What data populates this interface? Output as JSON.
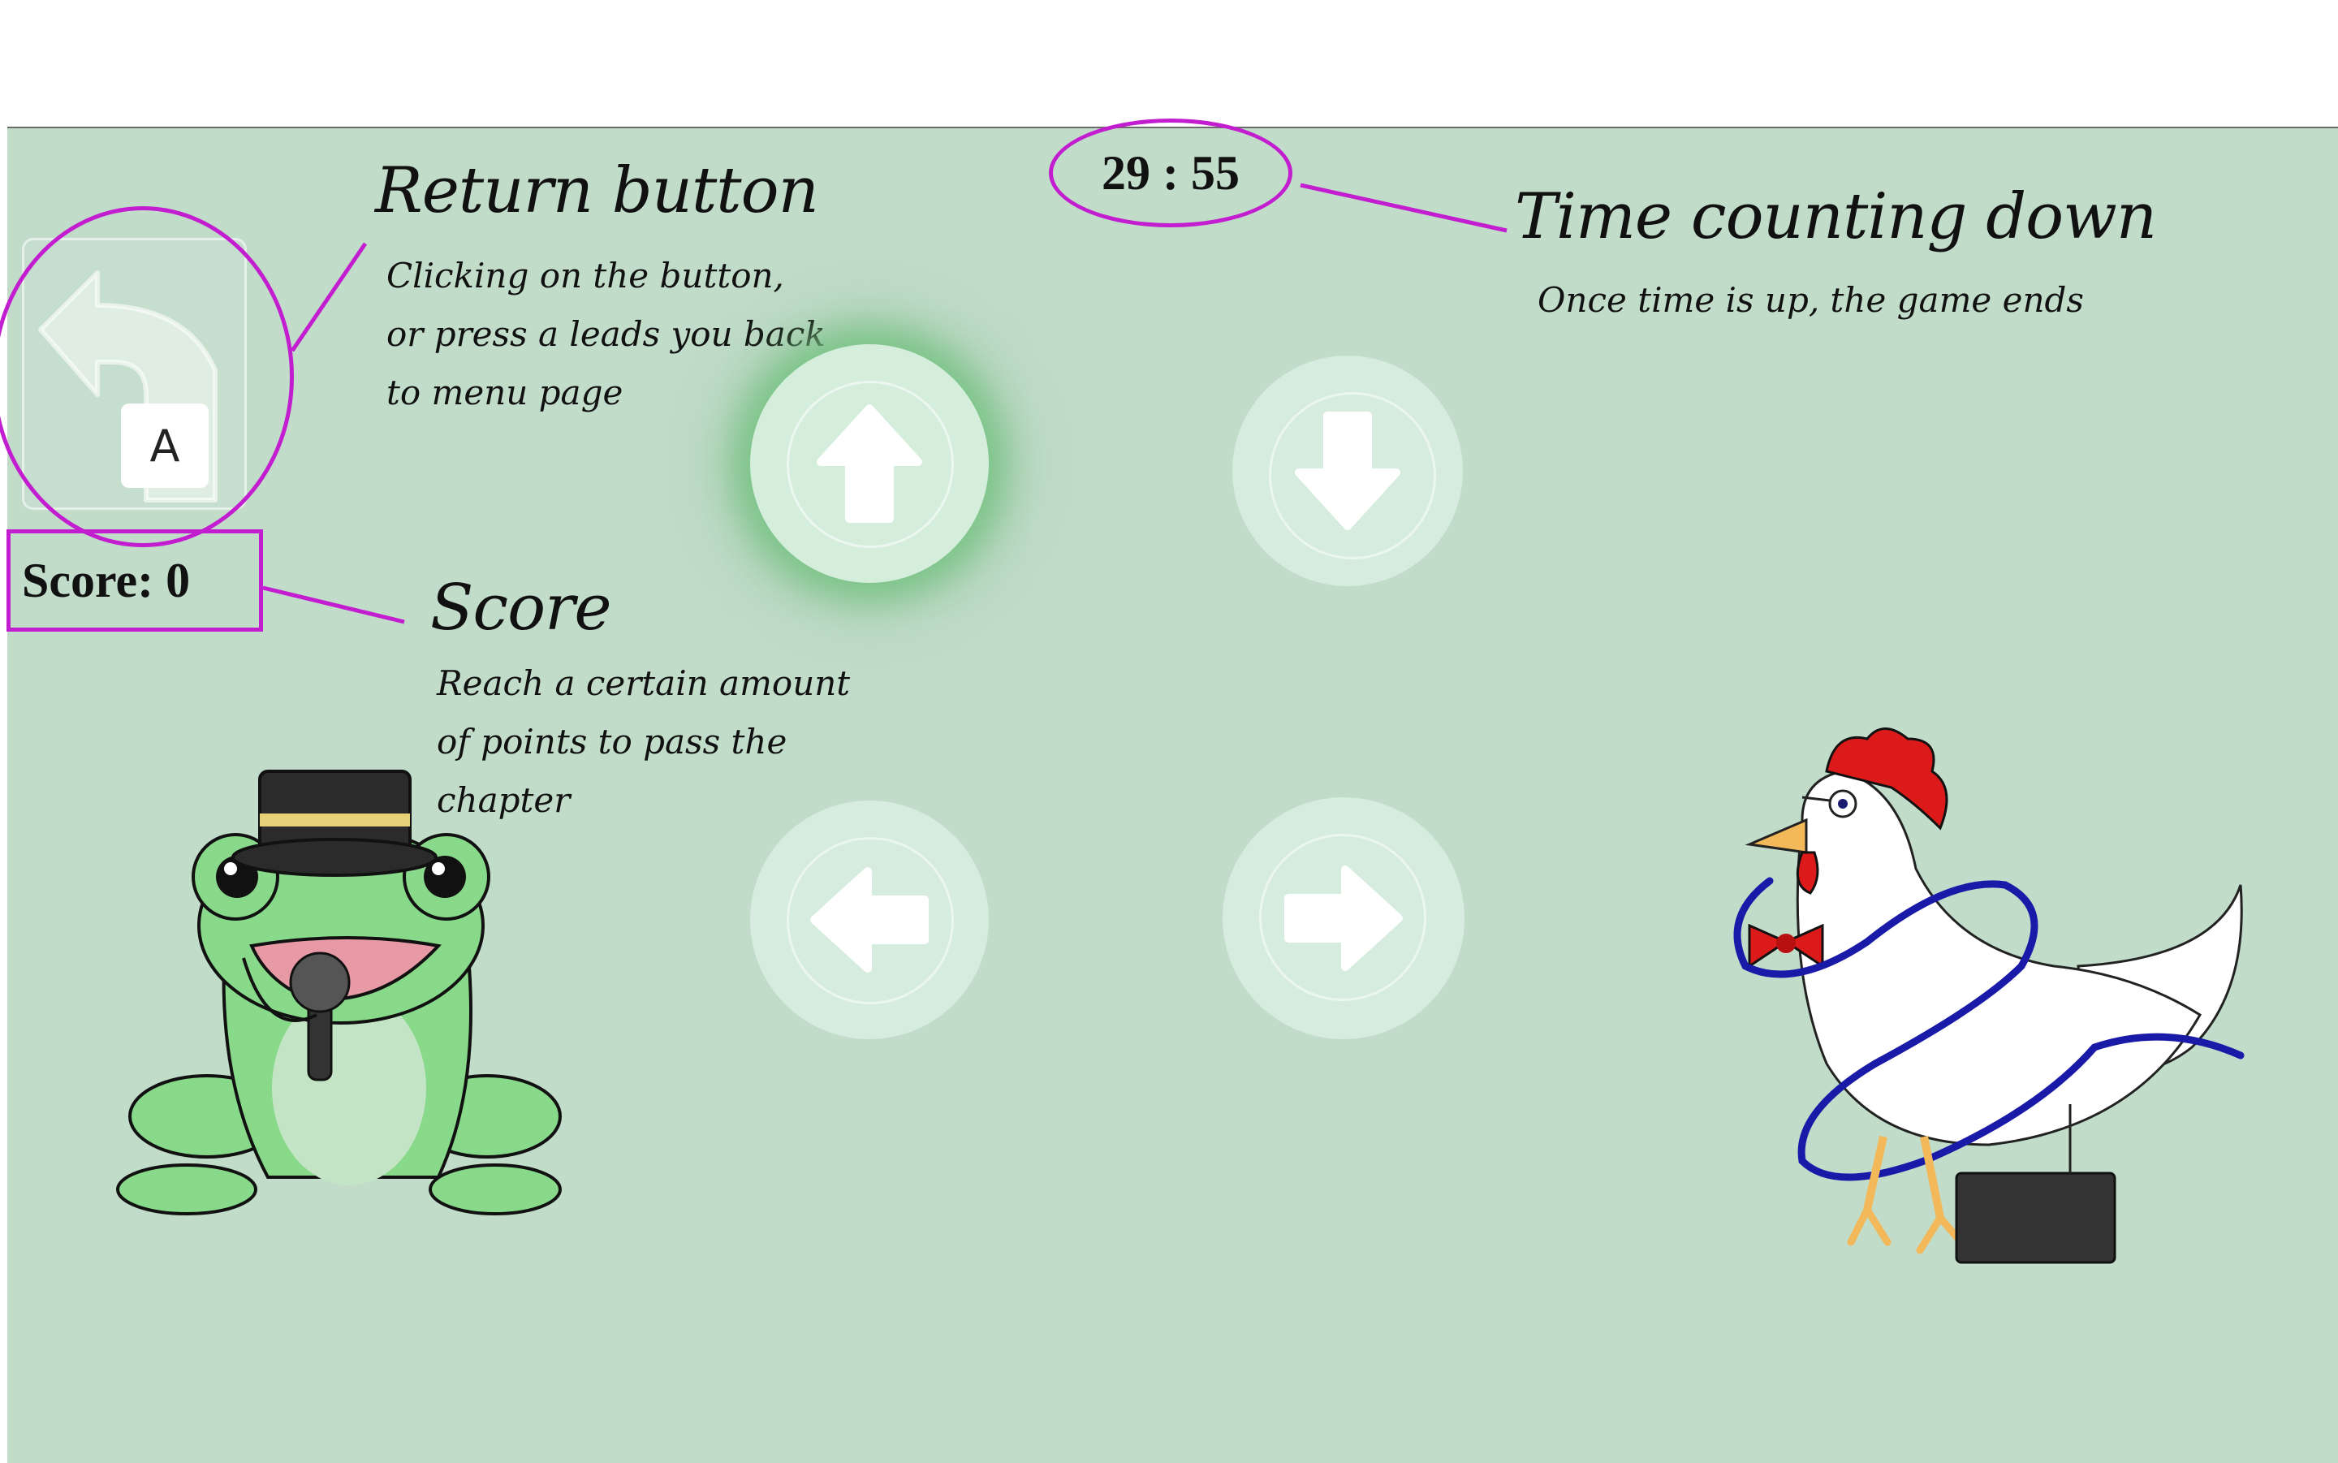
{
  "timer": {
    "text": "29 : 55"
  },
  "return_button": {
    "key_label": "A"
  },
  "score": {
    "text": "Score: 0"
  },
  "annotations": {
    "return": {
      "title": "Return button",
      "lines": [
        "Clicking on the button,",
        "or press a leads you back",
        "to menu page"
      ]
    },
    "time": {
      "title": "Time counting down",
      "lines": [
        "Once time is up, the game ends"
      ]
    },
    "score": {
      "title": "Score",
      "lines": [
        "Reach a certain amount",
        "of points to pass the",
        "chapter"
      ]
    }
  },
  "arrows": [
    {
      "direction": "up",
      "icon": "arrow-up-icon",
      "active": true
    },
    {
      "direction": "down",
      "icon": "arrow-down-icon",
      "active": false
    },
    {
      "direction": "left",
      "icon": "arrow-left-icon",
      "active": false
    },
    {
      "direction": "right",
      "icon": "arrow-right-icon",
      "active": false
    }
  ],
  "characters": [
    "frog-singer",
    "rooster-conductor"
  ],
  "colors": {
    "background": "#c1dcc9",
    "annotation": "#c21ed0",
    "arrow_glow": "#7bc488"
  }
}
